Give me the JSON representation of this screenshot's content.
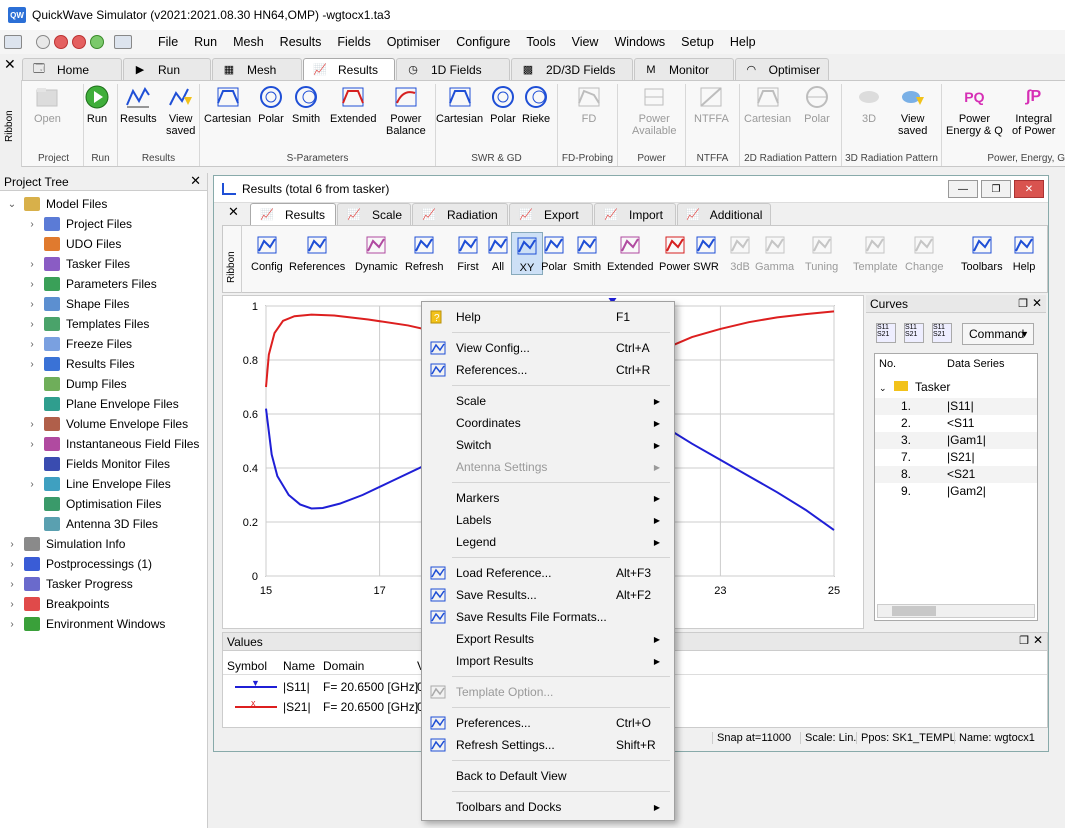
{
  "window": {
    "app_icon": "QW",
    "title": "QuickWave Simulator (v2021:2021.08.30 HN64,OMP) -wgtocx1.ta3"
  },
  "menubar": [
    "File",
    "Run",
    "Mesh",
    "Results",
    "Fields",
    "Optimiser",
    "Configure",
    "Tools",
    "View",
    "Windows",
    "Setup",
    "Help"
  ],
  "ribbon": {
    "side_label": "Ribbon",
    "tabs": [
      "Home",
      "Run",
      "Mesh",
      "Results",
      "1D Fields",
      "2D/3D Fields",
      "Monitor",
      "Optimiser"
    ],
    "active_tab": "Results",
    "groups": {
      "project": {
        "label": "Project",
        "open": "Open"
      },
      "run": {
        "label": "Run",
        "run": "Run"
      },
      "results": {
        "label": "Results",
        "results": "Results",
        "view_saved_1": "View",
        "view_saved_2": "saved"
      },
      "sparams": {
        "label": "S-Parameters",
        "cartesian": "Cartesian",
        "polar": "Polar",
        "smith": "Smith",
        "extended": "Extended",
        "power_balance_1": "Power",
        "power_balance_2": "Balance"
      },
      "swr": {
        "label": "SWR & GD",
        "cartesian": "Cartesian",
        "polar": "Polar",
        "rieke": "Rieke"
      },
      "fd": {
        "label": "FD-Probing",
        "fd": "FD"
      },
      "power": {
        "label": "Power",
        "pa_1": "Power",
        "pa_2": "Available"
      },
      "ntffa": {
        "label": "NTFFA",
        "ntffa": "NTFFA"
      },
      "rad2d": {
        "label": "2D Radiation Pattern",
        "cartesian": "Cartesian",
        "polar": "Polar"
      },
      "rad3d": {
        "label": "3D Radiation Pattern",
        "three_d": "3D",
        "view_saved_1": "View",
        "view_saved_2": "saved"
      },
      "energy": {
        "label": "Power, Energy, G",
        "pe_1": "Power",
        "pe_2": "Energy & Q",
        "ip_1": "Integral",
        "ip_2": "of Power"
      }
    }
  },
  "project_tree": {
    "title": "Project Tree",
    "items": [
      {
        "label": "Model Files",
        "chev": "⌄",
        "level": 0
      },
      {
        "label": "Project Files",
        "chev": "›",
        "level": 1
      },
      {
        "label": "UDO Files",
        "chev": "",
        "level": 1
      },
      {
        "label": "Tasker Files",
        "chev": "›",
        "level": 1
      },
      {
        "label": "Parameters Files",
        "chev": "›",
        "level": 1
      },
      {
        "label": "Shape Files",
        "chev": "›",
        "level": 1
      },
      {
        "label": "Templates Files",
        "chev": "›",
        "level": 1
      },
      {
        "label": "Freeze Files",
        "chev": "›",
        "level": 1
      },
      {
        "label": "Results Files",
        "chev": "›",
        "level": 1
      },
      {
        "label": "Dump Files",
        "chev": "",
        "level": 1
      },
      {
        "label": "Plane Envelope Files",
        "chev": "",
        "level": 1
      },
      {
        "label": "Volume Envelope Files",
        "chev": "›",
        "level": 1
      },
      {
        "label": "Instantaneous Field Files",
        "chev": "›",
        "level": 1
      },
      {
        "label": "Fields Monitor Files",
        "chev": "",
        "level": 1
      },
      {
        "label": "Line Envelope Files",
        "chev": "›",
        "level": 1
      },
      {
        "label": "Optimisation Files",
        "chev": "",
        "level": 1
      },
      {
        "label": "Antenna 3D Files",
        "chev": "",
        "level": 1
      },
      {
        "label": "Simulation Info",
        "chev": "›",
        "level": 0
      },
      {
        "label": "Postprocessings (1)",
        "chev": "›",
        "level": 0
      },
      {
        "label": "Tasker Progress",
        "chev": "›",
        "level": 0
      },
      {
        "label": "Breakpoints",
        "chev": "›",
        "level": 0
      },
      {
        "label": "Environment Windows",
        "chev": "›",
        "level": 0
      }
    ]
  },
  "results_window": {
    "title": "Results (total 6 from tasker)",
    "side_label": "Ribbon",
    "tabs": [
      "Results",
      "Scale",
      "Radiation",
      "Export",
      "Import",
      "Additional"
    ],
    "tools": [
      {
        "label": "Config",
        "dis": false
      },
      {
        "label": "References",
        "dis": false
      },
      {
        "label": "Dynamic",
        "dis": false
      },
      {
        "label": "Refresh",
        "dis": false
      },
      {
        "label": "First",
        "dis": false
      },
      {
        "label": "All",
        "dis": false
      },
      {
        "label": "XY",
        "dis": false
      },
      {
        "label": "Polar",
        "dis": false
      },
      {
        "label": "Smith",
        "dis": false
      },
      {
        "label": "Extended",
        "dis": false
      },
      {
        "label": "Power",
        "dis": false
      },
      {
        "label": "SWR",
        "dis": false
      },
      {
        "label": "3dB",
        "dis": true
      },
      {
        "label": "Gamma",
        "dis": true
      },
      {
        "label": "Tuning",
        "dis": true
      },
      {
        "label": "Template",
        "dis": true
      },
      {
        "label": "Change",
        "dis": true
      },
      {
        "label": "Toolbars",
        "dis": false
      },
      {
        "label": "Help",
        "dis": false
      }
    ]
  },
  "chart_data": {
    "type": "line",
    "x_ticks": [
      "15",
      "17",
      "19",
      "21",
      "23",
      "25"
    ],
    "y_ticks": [
      "0",
      "0.2",
      "0.4",
      "0.6",
      "0.8",
      "1"
    ],
    "xlim": [
      15,
      25
    ],
    "ylim": [
      0,
      1
    ],
    "grid": true,
    "series": [
      {
        "name": "|S11|",
        "color": "#1f1fd6",
        "points": [
          [
            15,
            0.62
          ],
          [
            15.1,
            0.45
          ],
          [
            15.2,
            0.37
          ],
          [
            15.4,
            0.3
          ],
          [
            15.6,
            0.265
          ],
          [
            15.8,
            0.25
          ],
          [
            16.0,
            0.252
          ],
          [
            16.3,
            0.268
          ],
          [
            16.7,
            0.3
          ],
          [
            17.2,
            0.35
          ],
          [
            17.8,
            0.41
          ],
          [
            18.2,
            0.44
          ],
          [
            18.5,
            0.47
          ],
          [
            20.3,
            0.62
          ],
          [
            20.8,
            0.66
          ],
          [
            21.1,
            0.68
          ],
          [
            21.6,
            0.61
          ],
          [
            22.0,
            0.555
          ],
          [
            22.5,
            0.49
          ],
          [
            23.0,
            0.43
          ],
          [
            23.5,
            0.37
          ],
          [
            24.0,
            0.31
          ],
          [
            24.5,
            0.245
          ],
          [
            25.0,
            0.17
          ]
        ]
      },
      {
        "name": "|S21|",
        "color": "#dd1f1f",
        "points": [
          [
            15,
            0.7
          ],
          [
            15.05,
            0.82
          ],
          [
            15.15,
            0.9
          ],
          [
            15.3,
            0.945
          ],
          [
            15.5,
            0.962
          ],
          [
            15.8,
            0.968
          ],
          [
            16.2,
            0.965
          ],
          [
            16.8,
            0.95
          ],
          [
            17.5,
            0.928
          ],
          [
            18.2,
            0.895
          ],
          [
            18.5,
            0.872
          ],
          [
            21.0,
            0.735
          ],
          [
            21.1,
            0.73
          ],
          [
            21.6,
            0.79
          ],
          [
            22.0,
            0.84
          ],
          [
            22.5,
            0.885
          ],
          [
            23.0,
            0.915
          ],
          [
            23.5,
            0.94
          ],
          [
            24.0,
            0.958
          ],
          [
            24.5,
            0.97
          ],
          [
            25.0,
            0.98
          ]
        ]
      }
    ]
  },
  "curves_panel": {
    "title": "Curves",
    "command_label": "Command",
    "headers": {
      "no": "No.",
      "series": "Data Series"
    },
    "group": "Tasker",
    "rows": [
      {
        "no": "1.",
        "name": "|S11|"
      },
      {
        "no": "2.",
        "name": "<S11"
      },
      {
        "no": "3.",
        "name": "|Gam1|"
      },
      {
        "no": "7.",
        "name": "|S21|"
      },
      {
        "no": "8.",
        "name": "<S21"
      },
      {
        "no": "9.",
        "name": "|Gam2|"
      }
    ]
  },
  "values_panel": {
    "title": "Values",
    "headers": {
      "symbol": "Symbol",
      "name": "Name",
      "domain": "Domain",
      "value": "V"
    },
    "rows": [
      {
        "name": "|S11|",
        "domain": "F= 20.6500 [GHz]",
        "value": "0",
        "color": "#1f1fd6",
        "marker": "▼"
      },
      {
        "name": "|S21|",
        "domain": "F= 20.6500 [GHz]",
        "value": "0",
        "color": "#dd1f1f",
        "marker": "x"
      }
    ]
  },
  "statusbar": {
    "snap": "Snap at=11000",
    "scale": "Scale: Lin.",
    "ppos": "Ppos: SK1_TEMPL",
    "name": "Name: wgtocx1"
  },
  "context_menu": {
    "items": [
      {
        "label": "Help",
        "key": "F1",
        "icon": "help-icon"
      },
      {
        "sep": true
      },
      {
        "label": "View Config...",
        "key": "Ctrl+A",
        "icon": "config-icon"
      },
      {
        "label": "References...",
        "key": "Ctrl+R",
        "icon": "references-icon"
      },
      {
        "sep": true
      },
      {
        "label": "Scale",
        "sub": true
      },
      {
        "label": "Coordinates",
        "sub": true
      },
      {
        "label": "Switch",
        "sub": true
      },
      {
        "label": "Antenna Settings",
        "sub": true,
        "dis": true
      },
      {
        "sep": true
      },
      {
        "label": "Markers",
        "sub": true
      },
      {
        "label": "Labels",
        "sub": true
      },
      {
        "label": "Legend",
        "sub": true
      },
      {
        "sep": true
      },
      {
        "label": "Load Reference...",
        "key": "Alt+F3",
        "icon": "load-icon"
      },
      {
        "label": "Save Results...",
        "key": "Alt+F2",
        "icon": "save-icon"
      },
      {
        "label": "Save Results File Formats...",
        "icon": "save-formats-icon"
      },
      {
        "label": "Export Results",
        "sub": true
      },
      {
        "label": "Import Results",
        "sub": true
      },
      {
        "sep": true
      },
      {
        "label": "Template Option...",
        "dis": true,
        "icon": "template-icon"
      },
      {
        "sep": true
      },
      {
        "label": "Preferences...",
        "key": "Ctrl+O",
        "icon": "preferences-icon"
      },
      {
        "label": "Refresh Settings...",
        "key": "Shift+R",
        "icon": "refresh-icon"
      },
      {
        "sep": true
      },
      {
        "label": "Back to Default View"
      },
      {
        "sep": true
      },
      {
        "label": "Toolbars and Docks",
        "sub": true
      }
    ]
  }
}
